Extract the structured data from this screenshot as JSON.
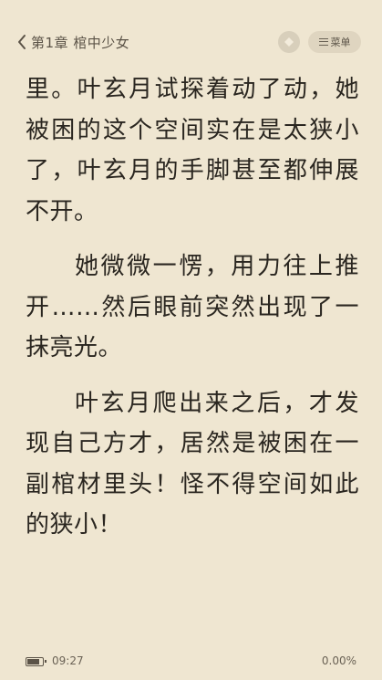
{
  "header": {
    "chapter_title": "第1章 棺中少女",
    "menu_label": "菜单",
    "icons": {
      "back": "chevron-left-icon",
      "nav": "diamond-icon",
      "menu": "hamburger-icon"
    }
  },
  "content": {
    "paragraphs": [
      {
        "indent": false,
        "text": "里。叶玄月试探着动了动，她被困的这个空间实在是太狭小了，叶玄月的手脚甚至都伸展不开。"
      },
      {
        "indent": true,
        "text": "她微微一愣，用力往上推开……然后眼前突然出现了一抹亮光。"
      },
      {
        "indent": true,
        "text": "叶玄月爬出来之后，才发现自己方才，居然是被困在一副棺材里头！怪不得空间如此的狭小！"
      }
    ]
  },
  "footer": {
    "time": "09:27",
    "progress": "0.00%",
    "battery_level": 0.7
  },
  "colors": {
    "background": "#efe6d1",
    "text": "#2a2620",
    "muted": "#5b5347"
  }
}
